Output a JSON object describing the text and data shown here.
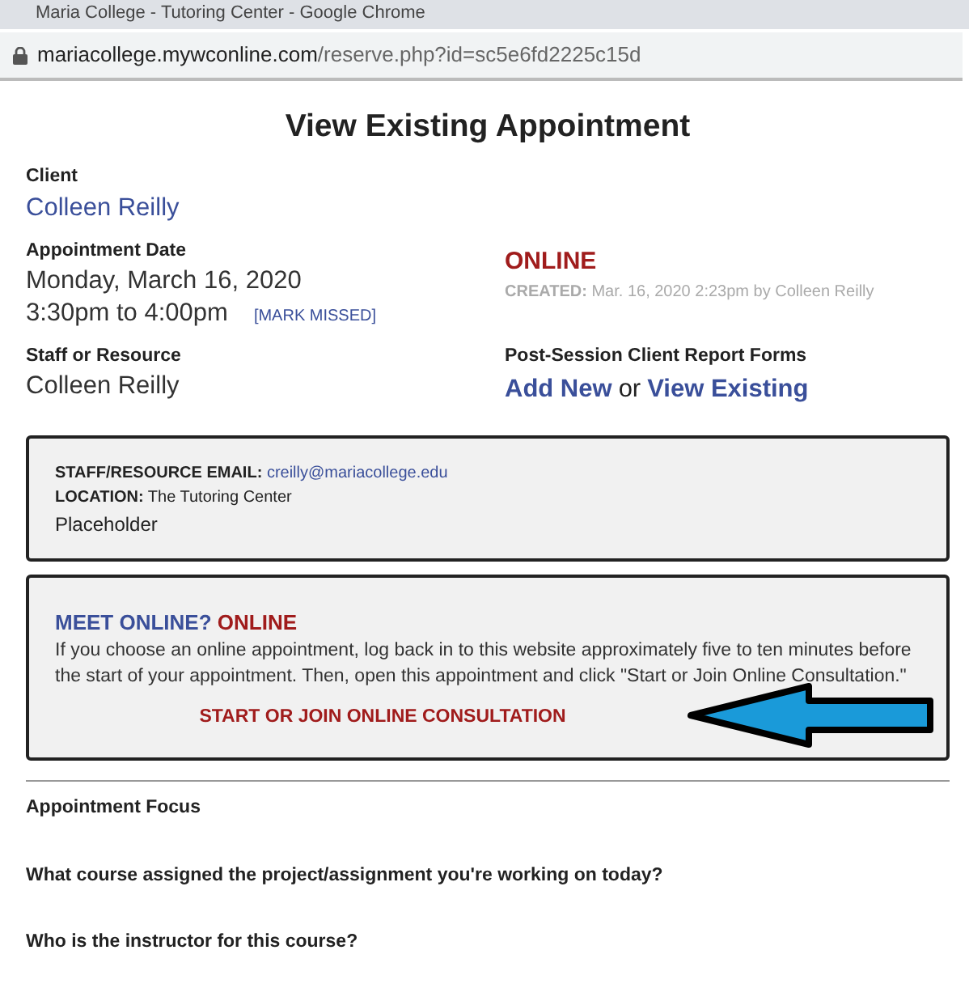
{
  "window": {
    "title": "Maria College - Tutoring Center - Google Chrome"
  },
  "address_bar": {
    "domain": "mariacollege.mywconline.com",
    "path": "/reserve.php?id=sc5e6fd2225c15d"
  },
  "page": {
    "title": "View Existing Appointment",
    "client": {
      "label": "Client",
      "value": "Colleen Reilly"
    },
    "appointment_date": {
      "label": "Appointment Date",
      "date": "Monday, March 16, 2020",
      "time": "3:30pm to 4:00pm",
      "action": "[MARK MISSED]"
    },
    "mode": {
      "value": "ONLINE",
      "created_label": "CREATED:",
      "created_value": "Mar. 16, 2020 2:23pm by Colleen Reilly"
    },
    "staff": {
      "label": "Staff or Resource",
      "value": "Colleen Reilly"
    },
    "report_forms": {
      "label": "Post-Session Client Report Forms",
      "links": [
        "Add New",
        "View Existing"
      ],
      "separator": "or"
    },
    "info_box": {
      "lines": [
        {
          "label": "STAFF/RESOURCE EMAIL:",
          "value": "creilly@mariacollege.edu",
          "kind": "link"
        },
        {
          "label": "LOCATION:",
          "value": "The Tutoring Center",
          "kind": "text"
        }
      ],
      "note": "Placeholder"
    },
    "online_box": {
      "heading": "MEET ONLINE?",
      "status": "ONLINE",
      "text": "If you choose an online appointment, log back in to this website approximately five to ten minutes before the start of your appointment. Then, open this appointment and click \"Start or Join Online Consultation.\"",
      "button": "START OR JOIN ONLINE CONSULTATION"
    },
    "questions": [
      "Appointment Focus",
      "What course assigned the project/assignment you're working on today?",
      "Who is the instructor for this course?"
    ]
  }
}
